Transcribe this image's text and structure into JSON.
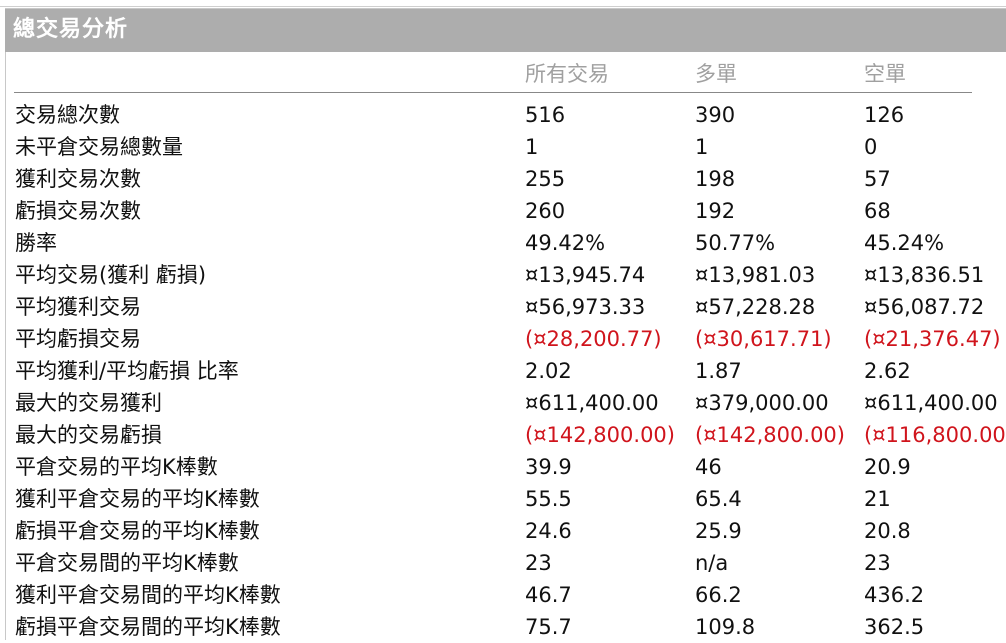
{
  "title": "總交易分析",
  "columns": {
    "all": "所有交易",
    "long": "多單",
    "short": "空單"
  },
  "colors": {
    "header_bg": "#adadad",
    "negative": "#d0141c",
    "column_header_text": "#a0a0a0"
  },
  "rows": [
    {
      "label": "交易總次數",
      "all": "516",
      "long": "390",
      "short": "126",
      "negative": false
    },
    {
      "label": "未平倉交易總數量",
      "all": "1",
      "long": "1",
      "short": "0",
      "negative": false
    },
    {
      "label": "獲利交易次數",
      "all": "255",
      "long": "198",
      "short": "57",
      "negative": false
    },
    {
      "label": "虧損交易次數",
      "all": "260",
      "long": "192",
      "short": "68",
      "negative": false
    },
    {
      "label": "勝率",
      "all": "49.42%",
      "long": "50.77%",
      "short": "45.24%",
      "negative": false
    },
    {
      "label": "平均交易(獲利  虧損)",
      "all": "¤13,945.74",
      "long": "¤13,981.03",
      "short": "¤13,836.51",
      "negative": false
    },
    {
      "label": "平均獲利交易",
      "all": "¤56,973.33",
      "long": "¤57,228.28",
      "short": "¤56,087.72",
      "negative": false
    },
    {
      "label": "平均虧損交易",
      "all": "(¤28,200.77)",
      "long": "(¤30,617.71)",
      "short": "(¤21,376.47)",
      "negative": true
    },
    {
      "label": "平均獲利/平均虧損  比率",
      "all": "2.02",
      "long": "1.87",
      "short": "2.62",
      "negative": false
    },
    {
      "label": "最大的交易獲利",
      "all": "¤611,400.00",
      "long": "¤379,000.00",
      "short": "¤611,400.00",
      "negative": false
    },
    {
      "label": "最大的交易虧損",
      "all": "(¤142,800.00)",
      "long": "(¤142,800.00)",
      "short": "(¤116,800.00)",
      "negative": true
    },
    {
      "label": "平倉交易的平均K棒數",
      "all": "39.9",
      "long": "46",
      "short": "20.9",
      "negative": false
    },
    {
      "label": "獲利平倉交易的平均K棒數",
      "all": "55.5",
      "long": "65.4",
      "short": "21",
      "negative": false
    },
    {
      "label": "虧損平倉交易的平均K棒數",
      "all": "24.6",
      "long": "25.9",
      "short": "20.8",
      "negative": false
    },
    {
      "label": "平倉交易間的平均K棒數",
      "all": "23",
      "long": "n/a",
      "short": "23",
      "negative": false
    },
    {
      "label": "獲利平倉交易間的平均K棒數",
      "all": "46.7",
      "long": "66.2",
      "short": "436.2",
      "negative": false
    },
    {
      "label": "虧損平倉交易間的平均K棒數",
      "all": "75.7",
      "long": "109.8",
      "short": "362.5",
      "negative": false
    }
  ]
}
